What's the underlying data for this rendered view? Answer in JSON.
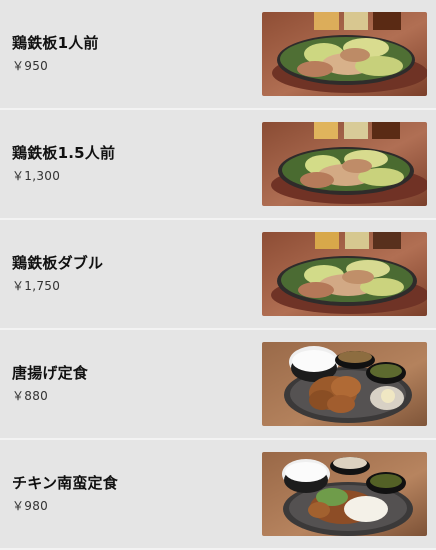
{
  "menu": {
    "items": [
      {
        "name": "鶏鉄板1人前",
        "price": "￥950",
        "image": "teppan-chicken-plate-image"
      },
      {
        "name": "鶏鉄板1.5人前",
        "price": "￥1,300",
        "image": "teppan-chicken-plate-image"
      },
      {
        "name": "鶏鉄板ダブル",
        "price": "￥1,750",
        "image": "teppan-chicken-plate-image"
      },
      {
        "name": "唐揚げ定食",
        "price": "￥880",
        "image": "karaage-set-meal-image"
      },
      {
        "name": "チキン南蛮定食",
        "price": "￥980",
        "image": "chicken-nanban-set-meal-image"
      }
    ]
  },
  "colors": {
    "background": "#e5e5e5",
    "divider": "#f3f3f3",
    "text": "#111111"
  }
}
